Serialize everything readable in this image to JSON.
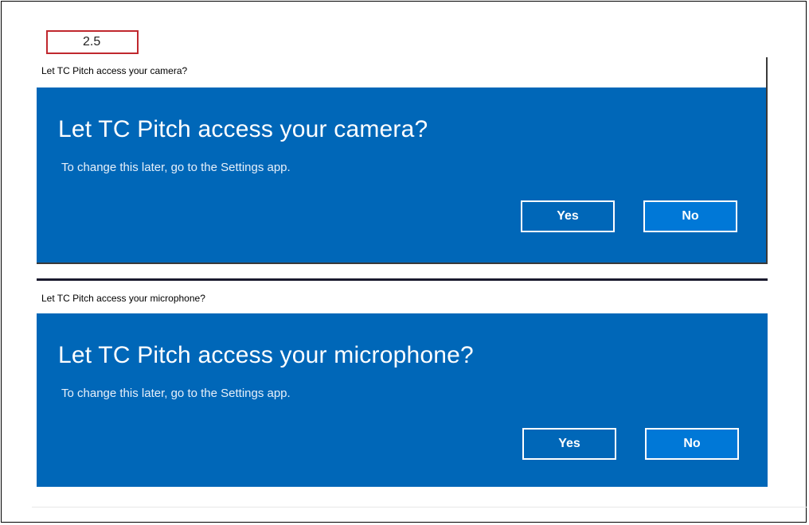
{
  "step_label": "2.5",
  "camera_dialog": {
    "window_title": "Let TC Pitch access your camera?",
    "heading": "Let TC Pitch access your camera?",
    "subtext": "To change this later, go to the Settings app.",
    "yes_label": "Yes",
    "no_label": "No"
  },
  "microphone_dialog": {
    "window_title": "Let TC Pitch access your microphone?",
    "heading": "Let TC Pitch access your microphone?",
    "subtext": "To change this later, go to the Settings app.",
    "yes_label": "Yes",
    "no_label": "No"
  },
  "colors": {
    "dialog_blue": "#0067b8",
    "badge_border": "#c0282e"
  }
}
